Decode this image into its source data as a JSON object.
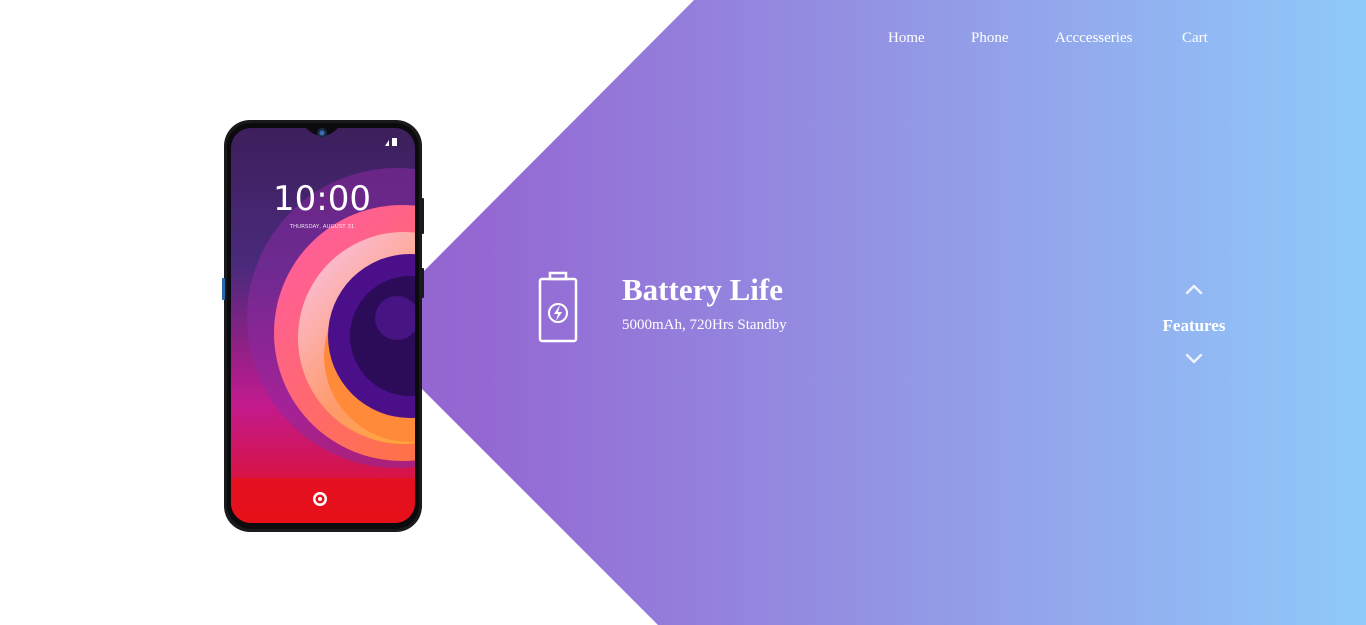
{
  "nav": {
    "items": [
      {
        "label": "Home"
      },
      {
        "label": "Phone"
      },
      {
        "label": "Acccesseries"
      },
      {
        "label": "Cart"
      }
    ]
  },
  "product": {
    "lock_time": "10:00",
    "lock_date": "THURSDAY, AUGUST 31"
  },
  "feature": {
    "icon": "battery-charging-icon",
    "title": "Battery Life",
    "description": "5000mAh, 720Hrs Standby"
  },
  "feature_nav": {
    "label": "Features",
    "up_icon": "chevron-up-icon",
    "down_icon": "chevron-down-icon"
  },
  "colors": {
    "gradient_start": "#9a5fcc",
    "gradient_mid": "#9467d3",
    "gradient_end": "#8fcafb",
    "text": "#ffffff"
  }
}
